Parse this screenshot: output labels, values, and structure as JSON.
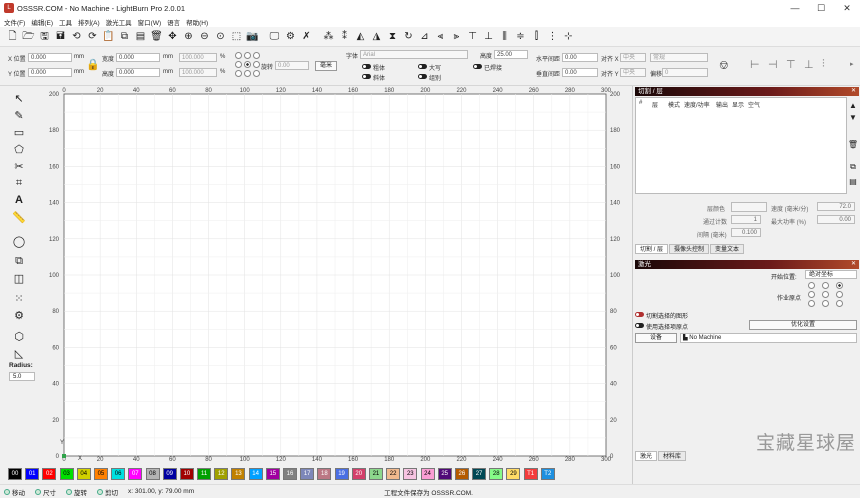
{
  "window": {
    "title": "OSSSR.COM - No Machine - LightBurn Pro 2.0.01",
    "minimize": "—",
    "maximize": "☐",
    "close": "✕"
  },
  "menu": [
    "文件(F)",
    "编辑(E)",
    "工具",
    "排列(A)",
    "激光工具",
    "窗口(W)",
    "语言",
    "帮助(H)"
  ],
  "props": {
    "x_label": "X 位置",
    "y_label": "Y 位置",
    "x_value": "0.000",
    "y_value": "0.000",
    "unit": "mm",
    "w_label": "宽度",
    "h_label": "高度",
    "w_value": "0.000",
    "h_value": "0.000",
    "w_pct": "100.000",
    "h_pct": "100.000",
    "pct": "%",
    "rotate_label": "旋转",
    "rotate_value": "0.00",
    "mm_button": "毫米",
    "font_label": "字体",
    "font_value": "Arial",
    "height_label": "高度",
    "height_value": "25.00",
    "bold": "粗体",
    "italic": "斜体",
    "upper": "大写",
    "center": "组别",
    "welded": "已焊接",
    "hspace_label": "水平间距",
    "hspace_value": "0.00",
    "vspace_label": "垂直间距",
    "vspace_value": "0.00",
    "align_x_label": "对齐 X",
    "align_x_value": "中央",
    "align_y_label": "对齐 Y",
    "align_y_value": "中央",
    "mode_value": "常规",
    "offset_label": "偏移",
    "offset_value": "0"
  },
  "tools": {
    "radius_label": "Radius:",
    "radius_value": "5.0"
  },
  "canvas": {
    "x_ticks": [
      "0",
      "20",
      "40",
      "60",
      "80",
      "100",
      "120",
      "140",
      "160",
      "180",
      "200",
      "220",
      "240",
      "260",
      "280",
      "300"
    ],
    "y_ticks": [
      "200",
      "180",
      "160",
      "140",
      "120",
      "100",
      "80",
      "60",
      "40",
      "20",
      "0"
    ],
    "x_axis": "X",
    "y_axis": "Y"
  },
  "palette": [
    {
      "label": "00",
      "color": "#000000",
      "text": "#ffffff"
    },
    {
      "label": "01",
      "color": "#0000ff",
      "text": "#ffffff"
    },
    {
      "label": "02",
      "color": "#ff0000",
      "text": "#ffffff"
    },
    {
      "label": "03",
      "color": "#00e000",
      "text": "#000000"
    },
    {
      "label": "04",
      "color": "#d0d000",
      "text": "#000000"
    },
    {
      "label": "05",
      "color": "#ff8000",
      "text": "#000000"
    },
    {
      "label": "06",
      "color": "#00e0e0",
      "text": "#000000"
    },
    {
      "label": "07",
      "color": "#ff00ff",
      "text": "#ffffff"
    },
    {
      "label": "08",
      "color": "#b4b4b4",
      "text": "#000000"
    },
    {
      "label": "09",
      "color": "#0000a0",
      "text": "#ffffff"
    },
    {
      "label": "10",
      "color": "#a00000",
      "text": "#ffffff"
    },
    {
      "label": "11",
      "color": "#00a000",
      "text": "#ffffff"
    },
    {
      "label": "12",
      "color": "#a0a000",
      "text": "#ffffff"
    },
    {
      "label": "13",
      "color": "#c08000",
      "text": "#ffffff"
    },
    {
      "label": "14",
      "color": "#00a0ff",
      "text": "#ffffff"
    },
    {
      "label": "15",
      "color": "#a000a0",
      "text": "#ffffff"
    },
    {
      "label": "16",
      "color": "#808080",
      "text": "#ffffff"
    },
    {
      "label": "17",
      "color": "#7d87b9",
      "text": "#ffffff"
    },
    {
      "label": "18",
      "color": "#bb7784",
      "text": "#ffffff"
    },
    {
      "label": "19",
      "color": "#4a6fe3",
      "text": "#ffffff"
    },
    {
      "label": "20",
      "color": "#d33f6a",
      "text": "#ffffff"
    },
    {
      "label": "21",
      "color": "#8cd78c",
      "text": "#000000"
    },
    {
      "label": "22",
      "color": "#f0b98d",
      "text": "#000000"
    },
    {
      "label": "23",
      "color": "#f6c4e1",
      "text": "#000000"
    },
    {
      "label": "24",
      "color": "#fa9ed4",
      "text": "#000000"
    },
    {
      "label": "25",
      "color": "#500a78",
      "text": "#ffffff"
    },
    {
      "label": "26",
      "color": "#b45a00",
      "text": "#ffffff"
    },
    {
      "label": "27",
      "color": "#004754",
      "text": "#ffffff"
    },
    {
      "label": "28",
      "color": "#86fa88",
      "text": "#000000"
    },
    {
      "label": "29",
      "color": "#ffdb66",
      "text": "#000000"
    },
    {
      "label": "T1",
      "color": "#f33c3c",
      "text": "#ffffff"
    },
    {
      "label": "T2",
      "color": "#1e90e0",
      "text": "#ffffff"
    }
  ],
  "status": {
    "move": "移动",
    "size": "尺寸",
    "rotate": "旋转",
    "cut": "剪切",
    "coords": "x: 301.00, y: 79.00 mm",
    "saved": "工程文件保存为 OSSSR.COM."
  },
  "panel": {
    "cuts_title": "切割 / 层",
    "close": "✕",
    "cols": {
      "num": "#",
      "layer": "层",
      "mode": "模式",
      "speed": "速度/功率",
      "output": "输出",
      "show": "显示",
      "air": "空气"
    },
    "layer_color_label": "层颜色",
    "speed_label": "速度 (毫米/分)",
    "speed_value": "72.0",
    "passes_label": "通过计数",
    "passes_value": "1",
    "maxpower_label": "最大功率 (%)",
    "maxpower_value": "0.00",
    "interval_label": "间隔 (毫米)",
    "interval_value": "0.100",
    "tabs": [
      "切割 / 层",
      "摄像头控制",
      "变量文本"
    ],
    "laser_title": "激光",
    "start_label": "开始位置:",
    "start_value": "绝对坐标",
    "origin_label": "作业原点",
    "cut_selected": "切割选择的图形",
    "use_origin": "使用选择项原点",
    "optimize_btn": "优化设置",
    "device_btn": "设备",
    "machine_value": "No Machine",
    "bottom_tabs": [
      "激光",
      "材料库"
    ]
  },
  "watermark": "宝藏星球屋"
}
